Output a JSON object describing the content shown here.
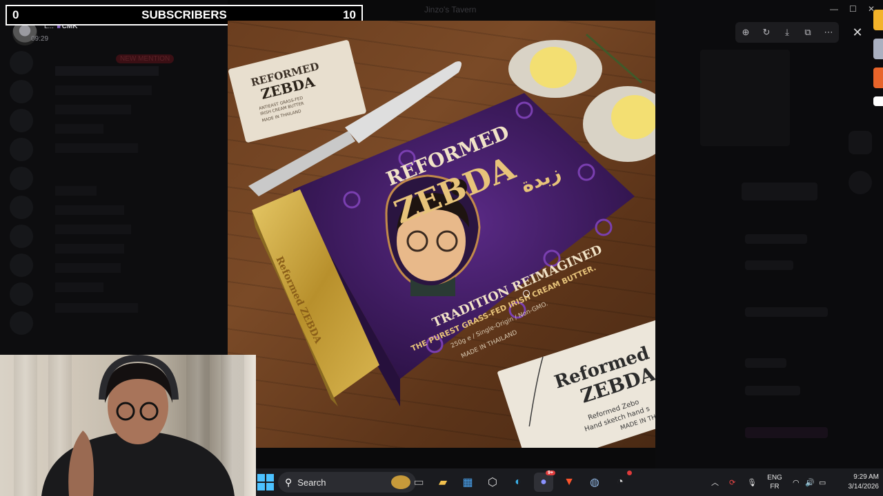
{
  "overlay": {
    "sub_count_current": "0",
    "sub_label": "SUBSCRIBERS",
    "sub_goal": "10"
  },
  "chat": {
    "user_name": "L...",
    "user_tag": "CMK",
    "timestamp": "09:29",
    "new_mention": "NEW MENTION"
  },
  "viewer": {
    "window_title": "Jinzo's Tavern",
    "controls": [
      "zoom-in-icon",
      "rotate-icon",
      "download-icon",
      "open-external-icon",
      "more-icon"
    ],
    "close_label": "✕"
  },
  "photo": {
    "brand_top": "REFORMED",
    "brand_main": "ZEBDA",
    "brand_arabic": "زبدة",
    "tagline": "TRADITION REIMAGINED",
    "sub_tagline": "THE PUREST GRASS-FED IRISH CREAM BUTTER.",
    "details": "250g e / Single-Origin / Non-GMO.",
    "made_in": "MADE IN THAILAND",
    "card_brand": "REFORMED ZEBDA",
    "card_line1": "ANTIEAST GRASS-FED",
    "card_line2": "IRISH CREAM BUTTER",
    "card_made": "MADE IN THAILAND",
    "foil_text": "Reformed ZEBDA",
    "sketch_brand_top": "Reformed",
    "sketch_brand_main": "ZEBDA",
    "sketch_line1": "Reformed Zebo",
    "sketch_line2": "Hand sketch hand s",
    "sketch_made": "MADE IN TH"
  },
  "taskbar": {
    "search_placeholder": "Search",
    "discord_badge": "9+",
    "lang_top": "ENG",
    "lang_bottom": "FR",
    "time": "9:29 AM",
    "date": "3/14/2026"
  },
  "colors": {
    "box_purple": "#3b1a5c",
    "foil_gold": "#c8a23a",
    "windows_blue": "#4cc2ff",
    "brave_orange": "#fb542b"
  }
}
